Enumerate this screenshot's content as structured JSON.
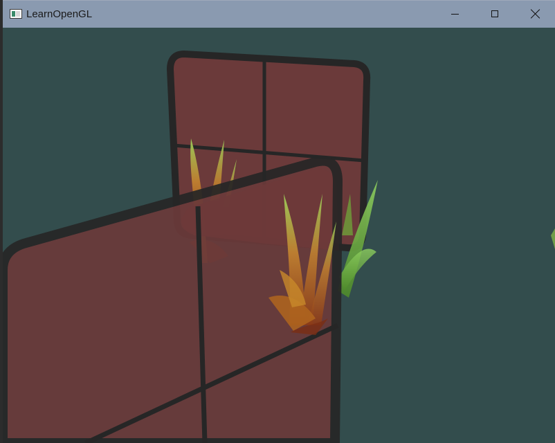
{
  "window": {
    "title": "LearnOpenGL",
    "controls": {
      "minimize": "minimize",
      "maximize": "maximize",
      "close": "close"
    }
  },
  "scene": {
    "clear_color": "#334d4d",
    "window_glass_color": "#6b3a3a",
    "window_overlap_color": "#8a3232",
    "frame_color": "#262626",
    "grass_colors": [
      "#c07a2a",
      "#a0552a",
      "#7fb24a"
    ]
  }
}
